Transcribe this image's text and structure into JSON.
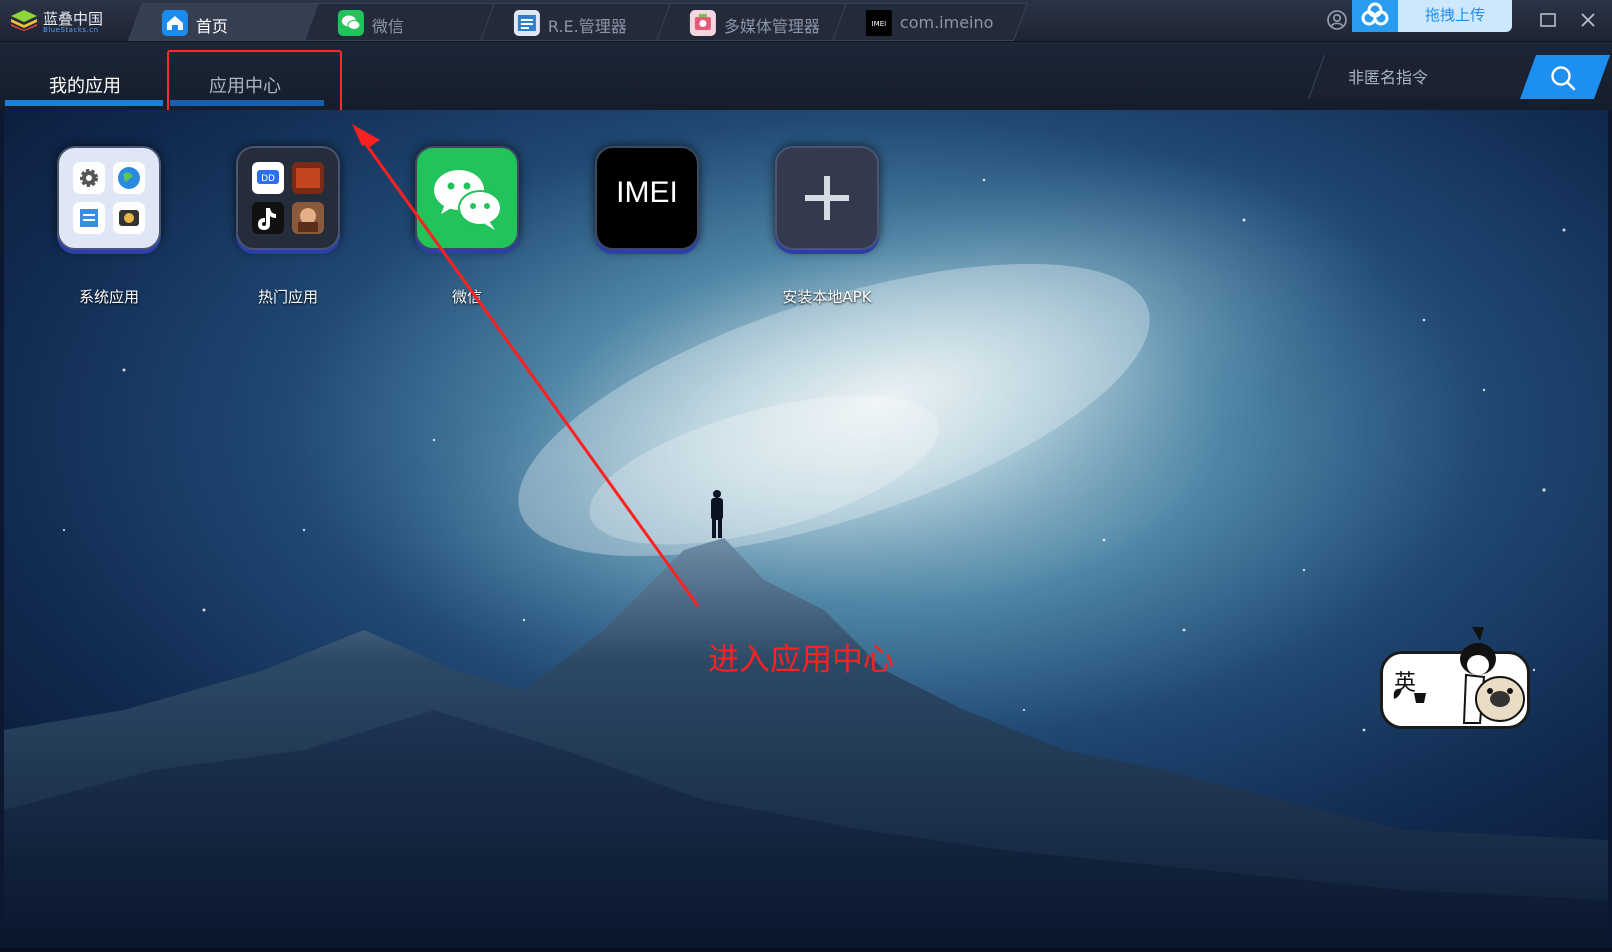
{
  "titlebar": {
    "logo": {
      "name": "蓝叠中国",
      "sub": "BlueStacks.cn"
    },
    "tabs": [
      {
        "label": "首页",
        "icon": "home-icon",
        "active": true
      },
      {
        "label": "微信",
        "icon": "wechat-icon",
        "active": false
      },
      {
        "label": "R.E.管理器",
        "icon": "file-manager-icon",
        "active": false
      },
      {
        "label": "多媒体管理器",
        "icon": "media-manager-icon",
        "active": false
      },
      {
        "label": "com.imeino",
        "icon": "imei-app-icon",
        "active": false
      }
    ],
    "upload_label": "拖拽上传"
  },
  "nav": {
    "tabs": [
      {
        "label": "我的应用",
        "active": true
      },
      {
        "label": "应用中心",
        "active": false
      }
    ]
  },
  "search": {
    "placeholder": "非匿名指令"
  },
  "apps": [
    {
      "label": "系统应用",
      "icon": "system-apps-folder-icon"
    },
    {
      "label": "热门应用",
      "icon": "hot-apps-folder-icon"
    },
    {
      "label": "微信",
      "icon": "wechat-icon"
    },
    {
      "label": "",
      "icon": "imei-app-icon",
      "icon_text": "IMEI"
    },
    {
      "label": "安装本地APK",
      "icon": "plus-icon"
    }
  ],
  "annotation": {
    "text": "进入应用中心"
  },
  "ime": {
    "char": "英"
  },
  "colors": {
    "accent": "#1c8ff0",
    "annotation_red": "#ff2b2b",
    "wechat_green": "#21c35a"
  }
}
